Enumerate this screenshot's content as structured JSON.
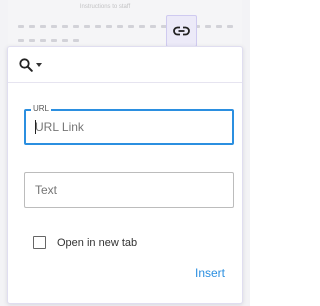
{
  "editor": {
    "title": "Instructions to staff",
    "link_tool_icon": "link-icon"
  },
  "popup": {
    "search_icon": "search-icon",
    "url_field": {
      "label": "URL",
      "placeholder": "URL Link",
      "value": ""
    },
    "text_field": {
      "placeholder": "Text",
      "value": ""
    },
    "new_tab": {
      "label": "Open in new tab",
      "checked": false
    },
    "insert_label": "Insert"
  },
  "colors": {
    "accent": "#2b8fe0",
    "link_tool_bg": "#eceaf8"
  }
}
